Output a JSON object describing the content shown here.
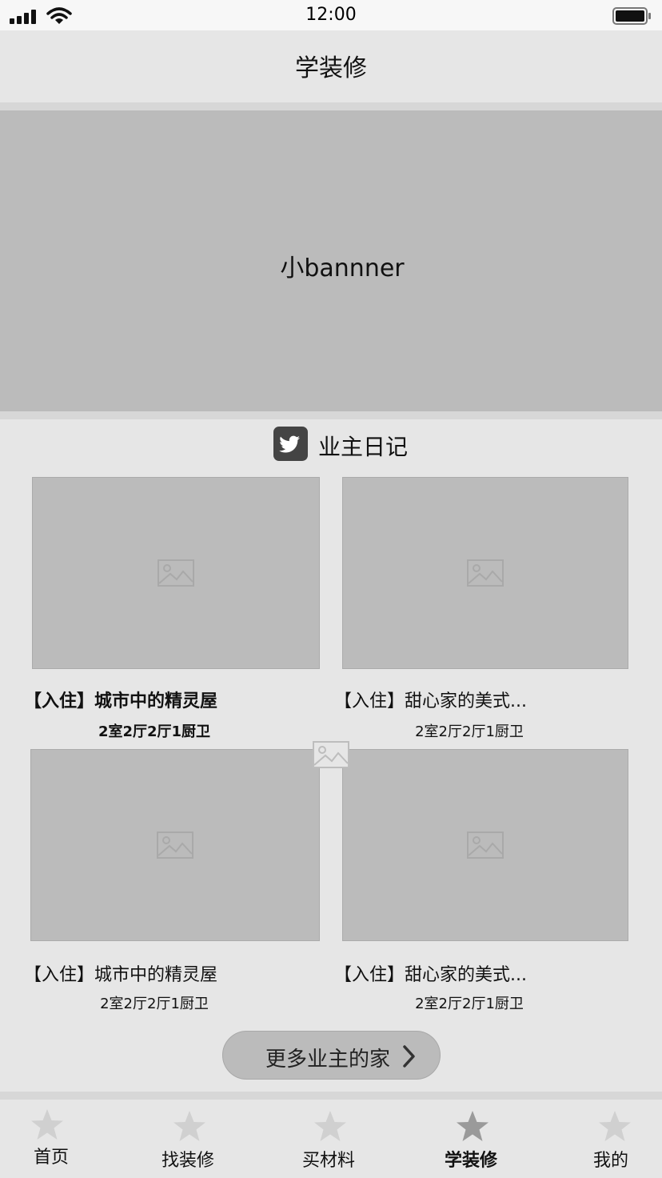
{
  "status_bar": {
    "time": "12:00"
  },
  "header": {
    "title": "学装修"
  },
  "banner": {
    "label": "小bannner"
  },
  "section": {
    "title": "业主日记",
    "icon": "twitter-bird-icon"
  },
  "diaries": [
    {
      "title": "【入住】城市中的精灵屋",
      "sub": "2室2厅2厅1厨卫"
    },
    {
      "title": "【入住】甜心家的美式...",
      "sub": "2室2厅2厅1厨卫"
    },
    {
      "title": "【入住】城市中的精灵屋",
      "sub": "2室2厅2厅1厨卫"
    },
    {
      "title": "【入住】甜心家的美式...",
      "sub": "2室2厅2厅1厨卫"
    }
  ],
  "more_button": {
    "label": "更多业主的家"
  },
  "tabs": [
    {
      "label": "首页",
      "icon": "star-icon"
    },
    {
      "label": "找装修",
      "icon": "star-icon"
    },
    {
      "label": "买材料",
      "icon": "star-icon"
    },
    {
      "label": "学装修",
      "icon": "star-icon",
      "active": true
    },
    {
      "label": "我的",
      "icon": "star-icon"
    }
  ],
  "colors": {
    "background": "#e6e6e6",
    "placeholder": "#bbbbbb",
    "status_bar": "#f7f7f7",
    "icon_dark": "#444444"
  }
}
